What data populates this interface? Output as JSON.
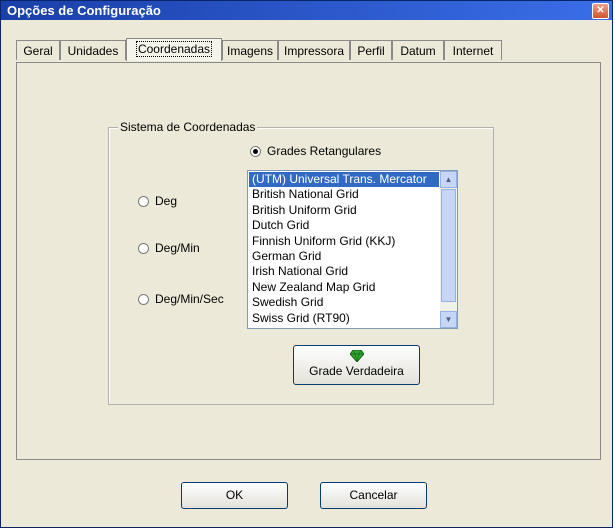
{
  "window": {
    "title": "Opções de Configuração",
    "close_label": "✕"
  },
  "tabs": [
    {
      "label": "Geral"
    },
    {
      "label": "Unidades"
    },
    {
      "label": "Coordenadas"
    },
    {
      "label": "Imagens"
    },
    {
      "label": "Impressora"
    },
    {
      "label": "Perfil"
    },
    {
      "label": "Datum"
    },
    {
      "label": "Internet"
    }
  ],
  "active_tab": "Coordenadas",
  "group": {
    "title": "Sistema de Coordenadas",
    "radios": {
      "grades": {
        "label": "Grades Retangulares",
        "checked": true
      },
      "deg": {
        "label": "Deg",
        "checked": false
      },
      "deg_min": {
        "label": "Deg/Min",
        "checked": false
      },
      "deg_min_sec": {
        "label": "Deg/Min/Sec",
        "checked": false
      }
    },
    "grid_list": {
      "selected": "(UTM) Universal Trans. Mercator",
      "items": [
        "(UTM) Universal Trans. Mercator",
        "British National Grid",
        "British Uniform Grid",
        "Dutch Grid",
        "Finnish Uniform Grid (KKJ)",
        "German Grid",
        "Irish National Grid",
        "New Zealand Map Grid",
        "Swedish Grid",
        "Swiss Grid (RT90)"
      ]
    },
    "true_grid_button": {
      "label": "Grade Verdadeira",
      "icon": "green-gem-icon"
    }
  },
  "footer": {
    "ok_label": "OK",
    "cancel_label": "Cancelar"
  },
  "colors": {
    "titlebar": "#2553c8",
    "selection": "#316ac5",
    "gem": "#2fa52f"
  }
}
